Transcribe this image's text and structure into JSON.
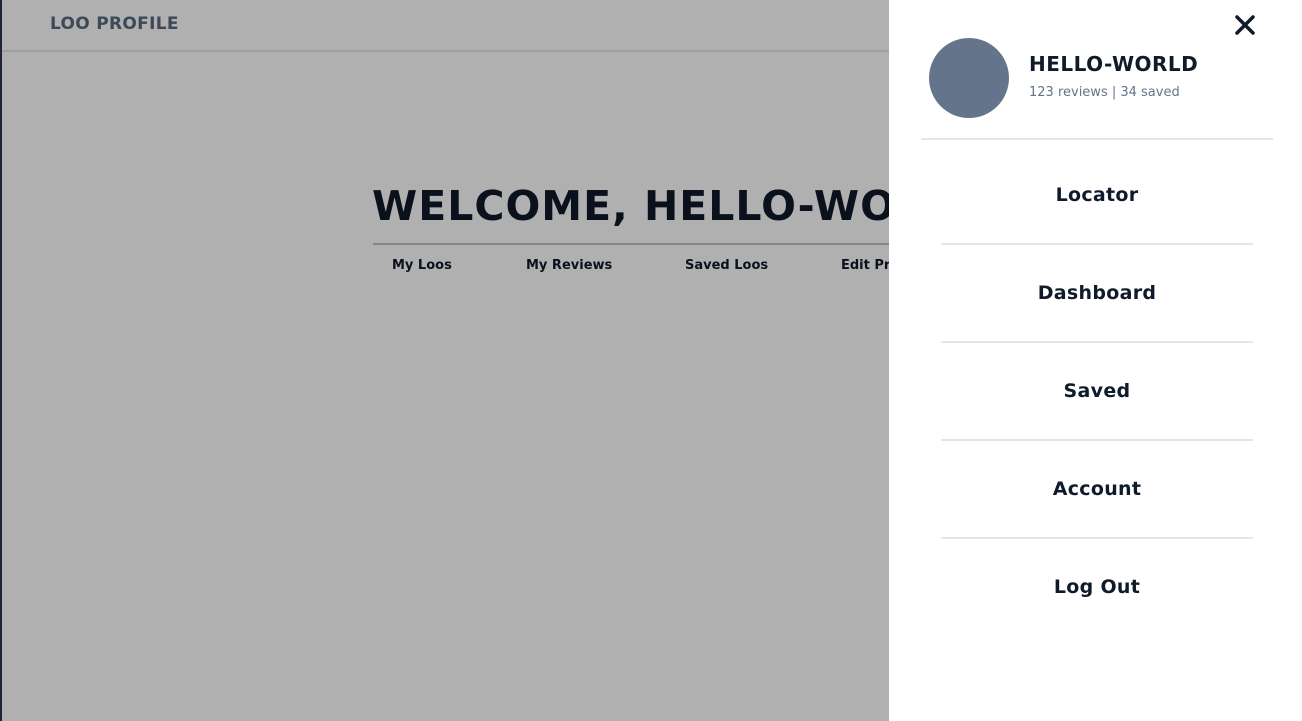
{
  "header": {
    "brand": "LOO PROFILE"
  },
  "main": {
    "welcome": "WELCOME, HELLO-WORLD",
    "tabs": [
      {
        "label": "My Loos"
      },
      {
        "label": "My Reviews"
      },
      {
        "label": "Saved Loos"
      },
      {
        "label": "Edit Profile"
      }
    ]
  },
  "drawer": {
    "username": "HELLO-WORLD",
    "stats": "123 reviews | 34 saved",
    "menu": [
      {
        "label": "Locator"
      },
      {
        "label": "Dashboard"
      },
      {
        "label": "Saved"
      },
      {
        "label": "Account"
      },
      {
        "label": "Log Out"
      }
    ]
  },
  "colors": {
    "text_dark": "#0f1a2b",
    "muted": "#64748b",
    "avatar": "#64748b",
    "overlay": "rgba(0,0,0,0.31)"
  },
  "icons": {
    "close": "close-icon"
  }
}
